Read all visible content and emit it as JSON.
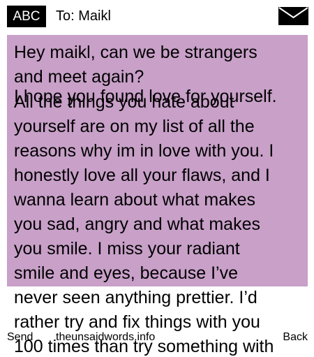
{
  "header": {
    "input_mode": "ABC",
    "recipient": "To: Maikl",
    "icon": "envelope-icon"
  },
  "message": {
    "lines": [
      "Hey maikl, can we be strangers",
      "and meet again?",
      "I hope you found love for yourself.",
      "All the things you hate about",
      "yourself are on my list of all the",
      "reasons why im in love with you. I",
      "honestly love all your flaws, and I",
      "wanna learn about what makes",
      "you sad, angry and what makes",
      "you smile. I miss your radiant",
      "smile and eyes, because I’ve",
      "never seen anything prettier. I’d",
      "rather try and fix things with you",
      "100 times than try something with"
    ]
  },
  "softkeys": {
    "left": "Send",
    "center": "theunsaidwords.info",
    "right": "Back"
  },
  "colors": {
    "message_background": "#c8a0c8",
    "badge_background": "#000000",
    "badge_text": "#ffffff"
  }
}
